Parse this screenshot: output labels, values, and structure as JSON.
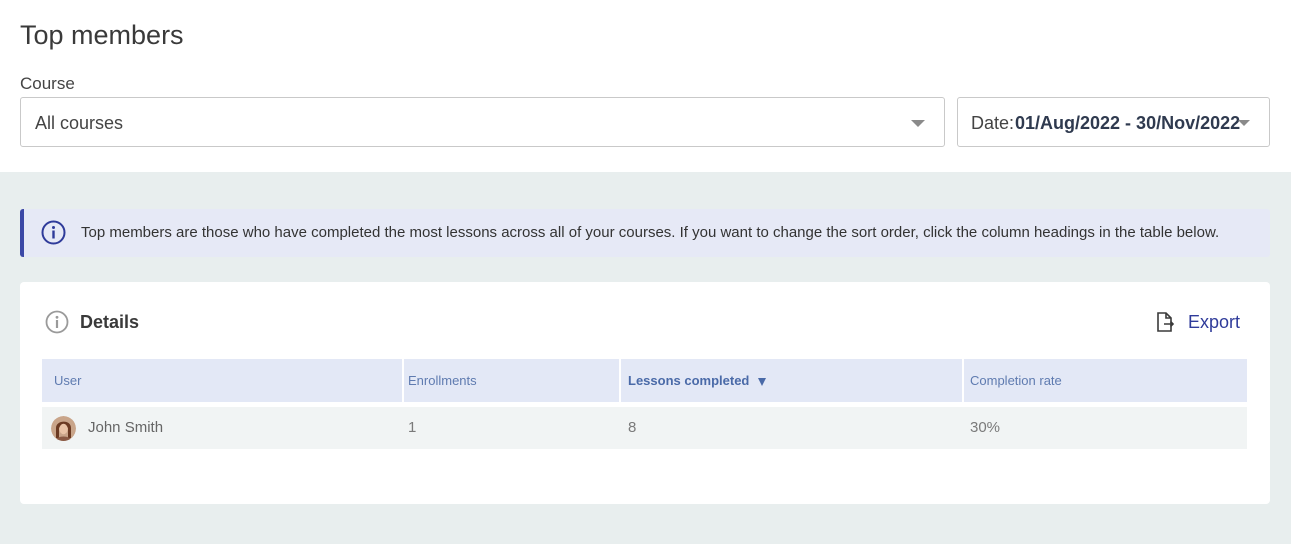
{
  "header": {
    "title": "Top members",
    "course_label": "Course",
    "course_select": {
      "value": "All courses"
    },
    "date_select": {
      "label": "Date:",
      "value": "01/Aug/2022 - 30/Nov/2022"
    }
  },
  "info_banner": {
    "icon": "info-icon",
    "text": "Top members are those who have completed the most lessons across all of your courses. If you want to change the sort order, click the column headings in the table below."
  },
  "details": {
    "title": "Details",
    "icon": "info-icon",
    "export": {
      "label": "Export",
      "icon": "export-file-icon"
    }
  },
  "table": {
    "columns": [
      {
        "label": "User"
      },
      {
        "label": "Enrollments"
      },
      {
        "label": "Lessons completed",
        "sorted": "desc"
      },
      {
        "label": "Completion rate"
      }
    ],
    "rows": [
      {
        "user": "John Smith",
        "enrollments": "1",
        "lessons_completed": "8",
        "completion_rate": "30%"
      }
    ]
  },
  "colors": {
    "accent": "#3b48a6",
    "link": "#2f3b9a",
    "banner_bg": "#e6e9f6",
    "table_header_bg": "#e3e8f6",
    "page_bg_lower": "#e8eeee"
  }
}
